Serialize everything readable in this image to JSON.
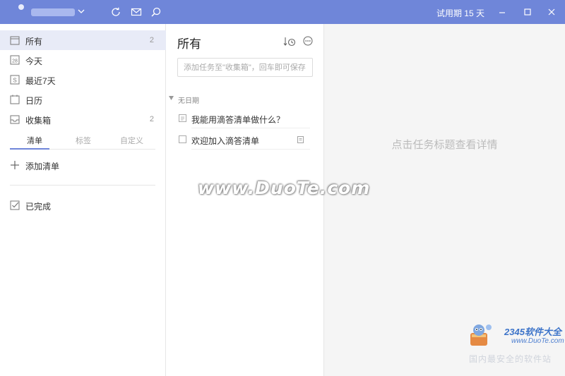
{
  "titlebar": {
    "trial_label": "试用期 15 天",
    "icons": [
      "sync-icon",
      "mail-icon",
      "search-icon"
    ],
    "window_controls": [
      "minimize-icon",
      "maximize-icon",
      "close-icon"
    ]
  },
  "sidebar": {
    "items": [
      {
        "label": "所有",
        "count": "2",
        "icon": "calendar-all-icon",
        "active": true
      },
      {
        "label": "今天",
        "count": "",
        "icon": "calendar-today-icon",
        "active": false
      },
      {
        "label": "最近7天",
        "count": "",
        "icon": "calendar-week-icon",
        "active": false
      },
      {
        "label": "日历",
        "count": "",
        "icon": "calendar-icon",
        "active": false
      },
      {
        "label": "收集箱",
        "count": "2",
        "icon": "inbox-icon",
        "active": false
      }
    ],
    "today_icon_text": "28",
    "week_icon_text": "S",
    "tabs": [
      {
        "label": "清单",
        "active": true
      },
      {
        "label": "标签",
        "active": false
      },
      {
        "label": "自定义",
        "active": false
      }
    ],
    "add_list_label": "添加清单",
    "completed_label": "已完成"
  },
  "list": {
    "title": "所有",
    "add_placeholder": "添加任务至\"收集箱\"，回车即可保存",
    "section_label": "无日期",
    "tasks": [
      {
        "title": "我能用滴答清单做什么？",
        "has_note": false
      },
      {
        "title": "欢迎加入滴答清单",
        "has_note": true
      }
    ]
  },
  "detail": {
    "empty_text": "点击任务标题查看详情"
  },
  "watermark": {
    "main": "www.DuoTe.com",
    "brand": "2345软件大全",
    "url": "www.DuoTe.com",
    "tagline": "国内最安全的软件站"
  },
  "colors": {
    "accent": "#6f86d9",
    "active_row": "#e8ebf7",
    "detail_bg": "#f5f5f5"
  }
}
